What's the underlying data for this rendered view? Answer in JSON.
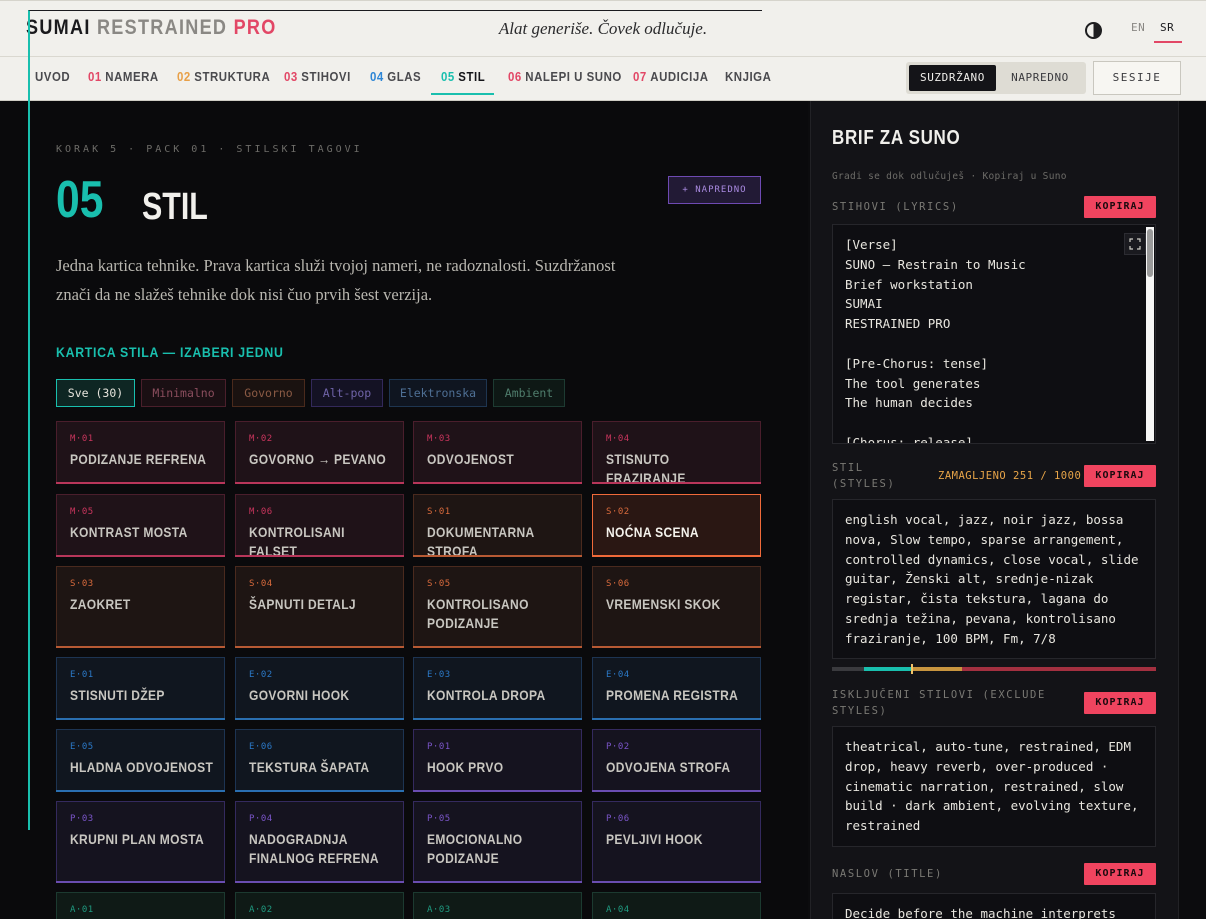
{
  "brand": {
    "part1": "SUMAI",
    "part2": "RESTRAINED",
    "part3": "PRO"
  },
  "tagline": "Alat generiše. Čovek odlučuje.",
  "lang": {
    "en": "EN",
    "sr": "SR",
    "active": "SR"
  },
  "icons": {
    "theme": "contrast-icon",
    "expand": "expand-icon"
  },
  "nav": {
    "items": [
      {
        "num": "",
        "label": "UVOD",
        "color": "#4a4a4e"
      },
      {
        "num": "01",
        "label": "NAMERA",
        "color": "#e24766"
      },
      {
        "num": "02",
        "label": "STRUKTURA",
        "color": "#e8a048"
      },
      {
        "num": "03",
        "label": "STIHOVI",
        "color": "#e24766"
      },
      {
        "num": "04",
        "label": "GLAS",
        "color": "#2e86d6"
      },
      {
        "num": "05",
        "label": "STIL",
        "color": "#19bfae",
        "active": true
      },
      {
        "num": "06",
        "label": "NALEPI U SUNO",
        "color": "#e24766"
      },
      {
        "num": "07",
        "label": "AUDICIJA",
        "color": "#e24766"
      },
      {
        "num": "",
        "label": "KNJIGA",
        "color": "#4a4a4e"
      }
    ],
    "mode": {
      "a": "SUZDRŽANO",
      "b": "NAPREDNO",
      "active": "SUZDRŽANO"
    },
    "sessions": "SESIJE"
  },
  "step": {
    "crumb": "KORAK 5 · PACK 01 · STILSKI TAGOVI",
    "num": "05",
    "title": "STIL",
    "advanced": "+ NAPREDNO",
    "lead": "Jedna kartica tehnike. Prava kartica služi tvojoj nameri, ne radoznalosti. Suzdržanost znači da ne slažeš tehnike dok nisi čuo prvih šest verzija."
  },
  "deck": {
    "title": "KARTICA STILA — IZABERI JEDNU",
    "filters": [
      {
        "label": "Sve (30)",
        "active": true
      },
      {
        "label": "Minimalno"
      },
      {
        "label": "Govorno"
      },
      {
        "label": "Alt-pop"
      },
      {
        "label": "Elektronska"
      },
      {
        "label": "Ambient"
      }
    ],
    "cards": [
      {
        "code": "M·01",
        "name": "PODIZANJE REFRENA"
      },
      {
        "code": "M·02",
        "name": "GOVORNO → PEVANO"
      },
      {
        "code": "M·03",
        "name": "ODVOJENOST"
      },
      {
        "code": "M·04",
        "name": "STISNUTO FRAZIRANJE"
      },
      {
        "code": "M·05",
        "name": "KONTRAST MOSTA"
      },
      {
        "code": "M·06",
        "name": "KONTROLISANI FALSET"
      },
      {
        "code": "S·01",
        "name": "DOKUMENTARNA STROFA"
      },
      {
        "code": "S·02",
        "name": "NOĆNA SCENA",
        "selected": true
      },
      {
        "code": "S·03",
        "name": "ZAOKRET"
      },
      {
        "code": "S·04",
        "name": "ŠAPNUTI DETALJ"
      },
      {
        "code": "S·05",
        "name": "KONTROLISANO PODIZANJE"
      },
      {
        "code": "S·06",
        "name": "VREMENSKI SKOK"
      },
      {
        "code": "E·01",
        "name": "STISNUTI DŽEP"
      },
      {
        "code": "E·02",
        "name": "GOVORNI HOOK"
      },
      {
        "code": "E·03",
        "name": "KONTROLA DROPA"
      },
      {
        "code": "E·04",
        "name": "PROMENA REGISTRA"
      },
      {
        "code": "E·05",
        "name": "HLADNA ODVOJENOST"
      },
      {
        "code": "E·06",
        "name": "TEKSTURA ŠAPATA"
      },
      {
        "code": "P·01",
        "name": "HOOK PRVO"
      },
      {
        "code": "P·02",
        "name": "ODVOJENA STROFA"
      },
      {
        "code": "P·03",
        "name": "KRUPNI PLAN MOSTA"
      },
      {
        "code": "P·04",
        "name": "NADOGRADNJA FINALNOG REFRENA"
      },
      {
        "code": "P·05",
        "name": "EMOCIONALNO PODIZANJE"
      },
      {
        "code": "P·06",
        "name": "PEVLJIVI HOOK"
      },
      {
        "code": "A·01",
        "name": ""
      },
      {
        "code": "A·02",
        "name": ""
      },
      {
        "code": "A·03",
        "name": ""
      },
      {
        "code": "A·04",
        "name": ""
      }
    ]
  },
  "colors": {
    "accent": "#19bfae",
    "copy": "#f0445f",
    "M": "#c9355d",
    "S": "#d86a3c",
    "E": "#2b78c6",
    "P": "#7a55c8",
    "A": "#1f9a80",
    "selected": "#f06a3a"
  },
  "brief": {
    "title": "BRIF ZA SUNO",
    "subtitle": "Gradi se dok odlučuješ · Kopiraj u Suno",
    "copy": "KOPIRAJ",
    "lyrics": {
      "label": "STIHOVI (LYRICS)",
      "text": "[Verse]\nSUNO — Restrain to Music\nBrief workstation\nSUMAI\nRESTRAINED PRO\n\n[Pre-Chorus: tense]\nThe tool generates\nThe human decides\n\n[Chorus: release]"
    },
    "style": {
      "label": "STIL (STYLES)",
      "status": "ZAMAGLJENO",
      "count": "251 / 1000",
      "used": 251,
      "max": 1000,
      "text": "english vocal, jazz, noir jazz, bossa nova, Slow tempo, sparse arrangement, controlled dynamics, close vocal, slide guitar, Ženski alt, srednje-nizak registar, čista tekstura, lagana do srednja težina, pevana, kontrolisano fraziranje, 100 BPM, Fm, 7/8"
    },
    "exclude": {
      "label": "ISKLJUČENI STILOVI (EXCLUDE STYLES)",
      "text": "theatrical, auto-tune, restrained, EDM drop, heavy reverb, over-produced · cinematic narration, restrained, slow build · dark ambient, evolving texture, restrained"
    },
    "title_field": {
      "label": "NASLOV (TITLE)",
      "text": "Decide before the machine interprets"
    }
  }
}
